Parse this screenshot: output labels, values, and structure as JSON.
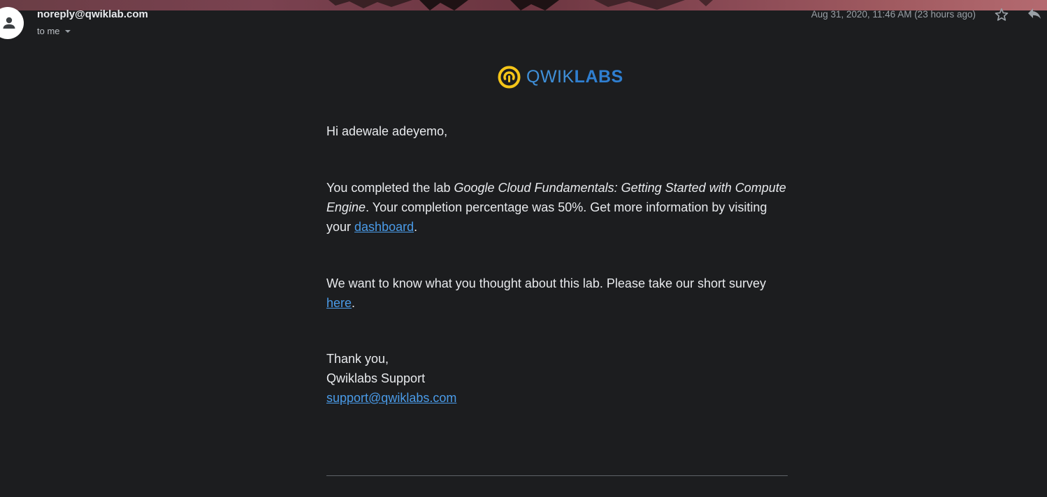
{
  "message": {
    "sender": "noreply@qwiklab.com",
    "recipient_label": "to me",
    "date": "Aug 31, 2020, 11:46 AM (23 hours ago)"
  },
  "brand": {
    "logo_light": "QWIK",
    "logo_bold": "LABS"
  },
  "body": {
    "greeting": "Hi adewale adeyemo,",
    "p1_prefix": "You completed the lab ",
    "lab_name": "Google Cloud Fundamentals: Getting Started with Compute Engine",
    "p1_middle": ". Your completion percentage was 50%. Get more information by visiting your ",
    "dashboard_link": "dashboard",
    "p1_suffix": ".",
    "p2_prefix": "We want to know what you thought about this lab. Please take our short survey ",
    "survey_link": "here",
    "p2_suffix": ".",
    "signoff": "Thank you,",
    "team": "Qwiklabs Support",
    "support_email": "support@qwiklabs.com"
  },
  "icons": {
    "avatar": "person-icon",
    "dropdown": "caret-down-icon",
    "star": "star-icon",
    "reply": "reply-icon",
    "logo": "qwiklabs-logo-icon"
  },
  "colors": {
    "background": "#1c1d1f",
    "text": "#e8eaed",
    "link": "#4a9be8",
    "logo_yellow": "#f5c518",
    "logo_blue": "#2f7fd1"
  }
}
